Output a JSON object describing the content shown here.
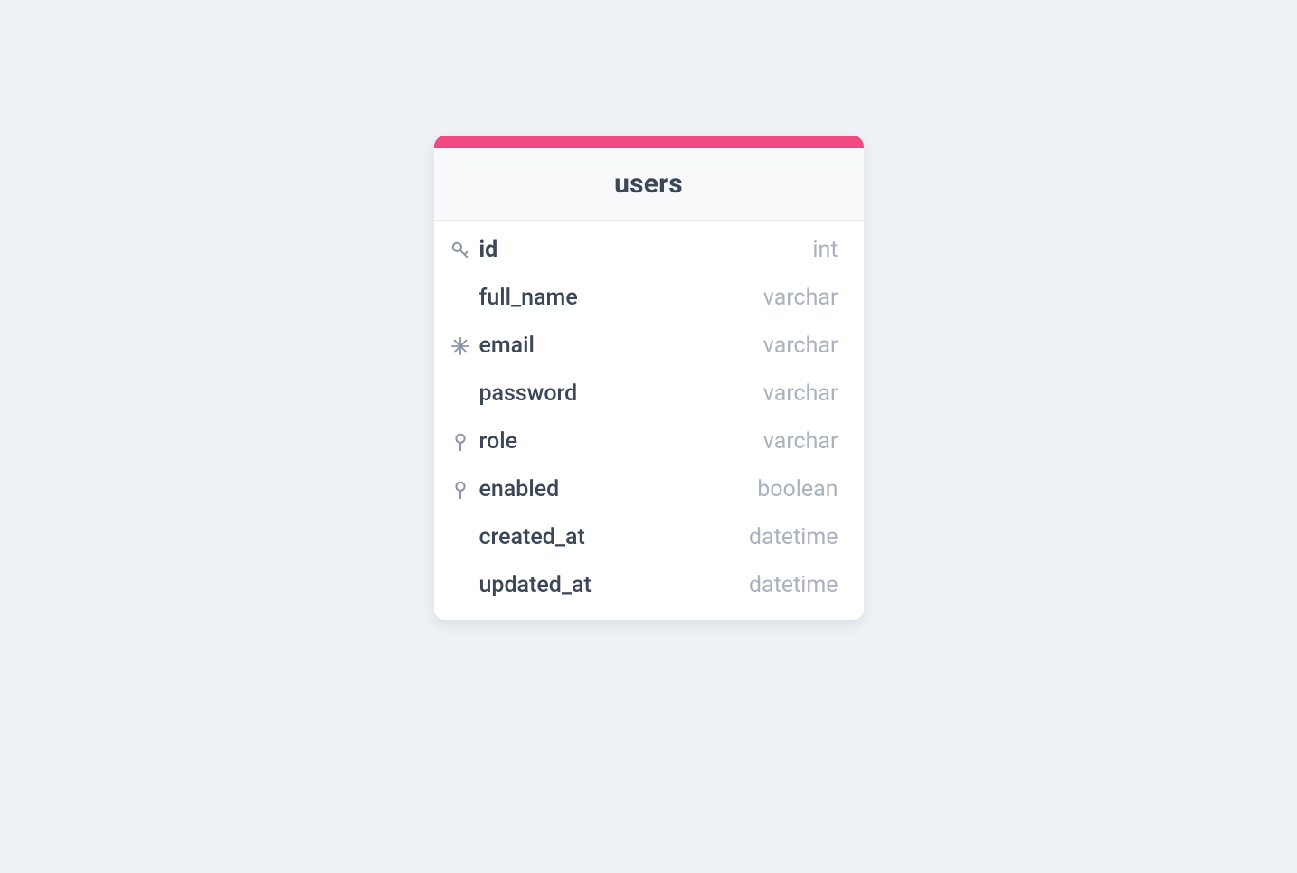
{
  "table": {
    "name": "users",
    "accent_color": "#ef4a81",
    "columns": [
      {
        "name": "id",
        "type": "int",
        "icon": "key",
        "pk": true
      },
      {
        "name": "full_name",
        "type": "varchar",
        "icon": null,
        "pk": false
      },
      {
        "name": "email",
        "type": "varchar",
        "icon": "snowflake",
        "pk": false
      },
      {
        "name": "password",
        "type": "varchar",
        "icon": null,
        "pk": false
      },
      {
        "name": "role",
        "type": "varchar",
        "icon": "pin",
        "pk": false
      },
      {
        "name": "enabled",
        "type": "boolean",
        "icon": "pin",
        "pk": false
      },
      {
        "name": "created_at",
        "type": "datetime",
        "icon": null,
        "pk": false
      },
      {
        "name": "updated_at",
        "type": "datetime",
        "icon": null,
        "pk": false
      }
    ]
  }
}
